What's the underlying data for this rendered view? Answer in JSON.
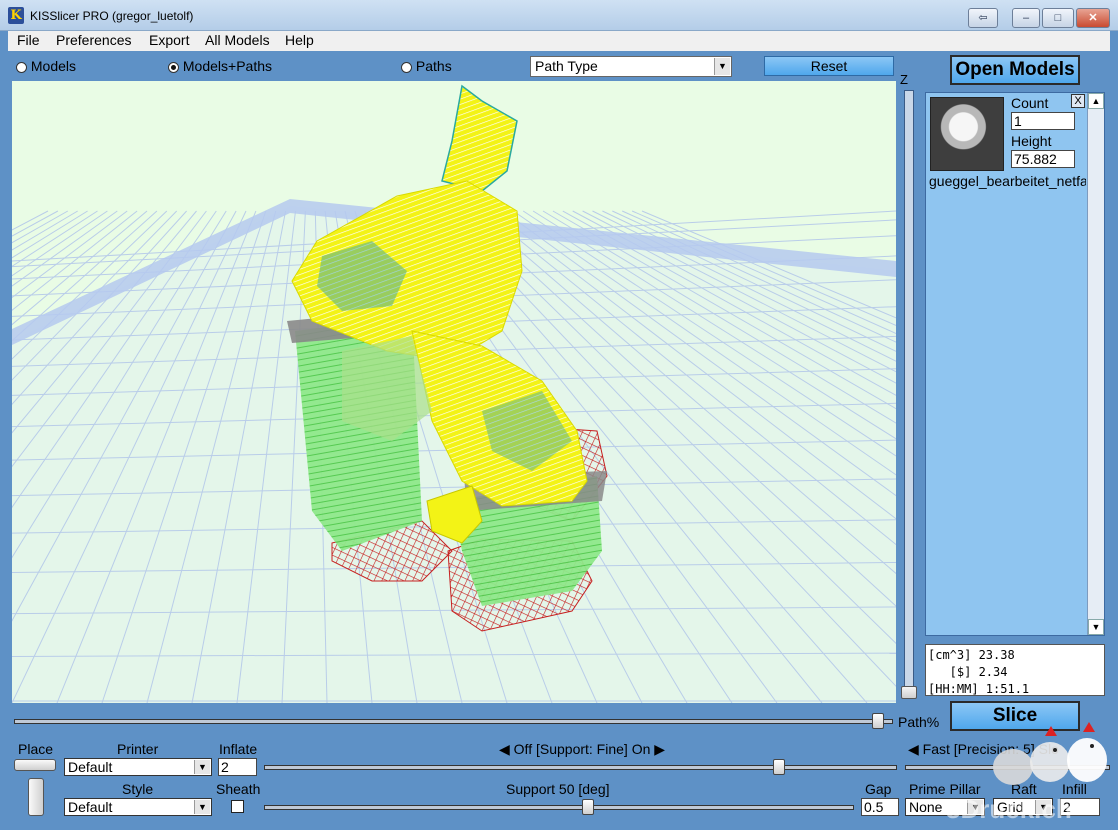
{
  "window": {
    "title": "KISSlicer PRO (gregor_luetolf)",
    "icon_letter": "K",
    "controls": {
      "restore_down": "⇦",
      "minimize": "–",
      "maximize": "□",
      "close": "✕"
    }
  },
  "menu": {
    "items": [
      "File",
      "Preferences",
      "Export",
      "All Models",
      "Help"
    ]
  },
  "view_modes": {
    "models": "Models",
    "models_paths": "Models+Paths",
    "paths": "Paths",
    "selected": "Models+Paths"
  },
  "path_type": {
    "value": "Path Type"
  },
  "reset_label": "Reset",
  "z_label": "Z",
  "open_models_label": "Open Models",
  "model": {
    "count_label": "Count",
    "count_value": "1",
    "height_label": "Height",
    "height_value": "75.882",
    "name": "gueggel_bearbeitet_netfa",
    "close_label": "X"
  },
  "stats": {
    "volume": "[cm^3] 23.38",
    "cost": "   [$] 2.34",
    "time": "[HH:MM] 1:51.1"
  },
  "path_pct_label": "Path%",
  "slice_label": "Slice",
  "controls": {
    "place_label": "Place",
    "printer_label": "Printer",
    "printer_value": "Default",
    "inflate_label": "Inflate",
    "inflate_value": "2",
    "support_toggle": "Off [Support: Fine] On",
    "speed_toggle": "Fast [Precision: 5] Slo",
    "style_label": "Style",
    "style_value": "Default",
    "sheath_label": "Sheath",
    "support_angle": "Support 50 [deg]",
    "gap_label": "Gap",
    "gap_value": "0.5",
    "prime_pillar_label": "Prime Pillar",
    "prime_pillar_value": "None",
    "raft_label": "Raft",
    "raft_value": "Grid",
    "infill_label": "Infill",
    "infill_value": "2"
  },
  "levels": {
    "path_pct": 0.99,
    "z": 0.0,
    "support_slider": 0.82,
    "support_angle_slider": 0.55
  },
  "watermark": "3Druck.ch",
  "colors": {
    "background": "#5e91c6",
    "viewport": "#e9fce5",
    "grid": "#b9cde9",
    "button": "#4fa7ec",
    "model_yellow": "#f3f316",
    "model_green": "#73e66b",
    "support_grey": "#8a8a8a",
    "raft_red": "#c62020"
  }
}
